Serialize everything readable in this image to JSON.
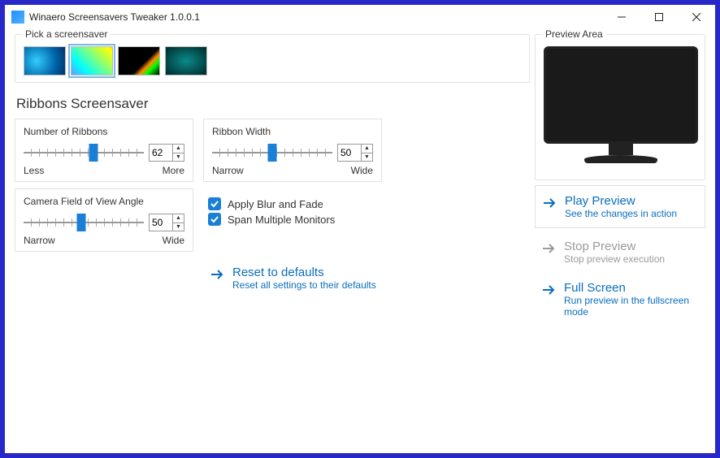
{
  "window": {
    "title": "Winaero Screensavers Tweaker 1.0.0.1"
  },
  "picker": {
    "label": "Pick a screensaver"
  },
  "section": {
    "title": "Ribbons Screensaver"
  },
  "ribbons_count": {
    "label": "Number of Ribbons",
    "value": "62",
    "min_label": "Less",
    "max_label": "More",
    "pct": 58
  },
  "ribbon_width": {
    "label": "Ribbon Width",
    "value": "50",
    "min_label": "Narrow",
    "max_label": "Wide",
    "pct": 50
  },
  "fov": {
    "label": "Camera Field of View Angle",
    "value": "50",
    "min_label": "Narrow",
    "max_label": "Wide",
    "pct": 48
  },
  "cb_blur": {
    "label": "Apply Blur and Fade",
    "checked": true
  },
  "cb_span": {
    "label": "Span Multiple Monitors",
    "checked": true
  },
  "reset": {
    "title": "Reset to defaults",
    "sub": "Reset all settings to their defaults"
  },
  "preview": {
    "label": "Preview Area",
    "play": {
      "title": "Play Preview",
      "sub": "See the changes in action"
    },
    "stop": {
      "title": "Stop Preview",
      "sub": "Stop preview execution"
    },
    "full": {
      "title": "Full Screen",
      "sub": "Run preview in the fullscreen mode"
    }
  }
}
